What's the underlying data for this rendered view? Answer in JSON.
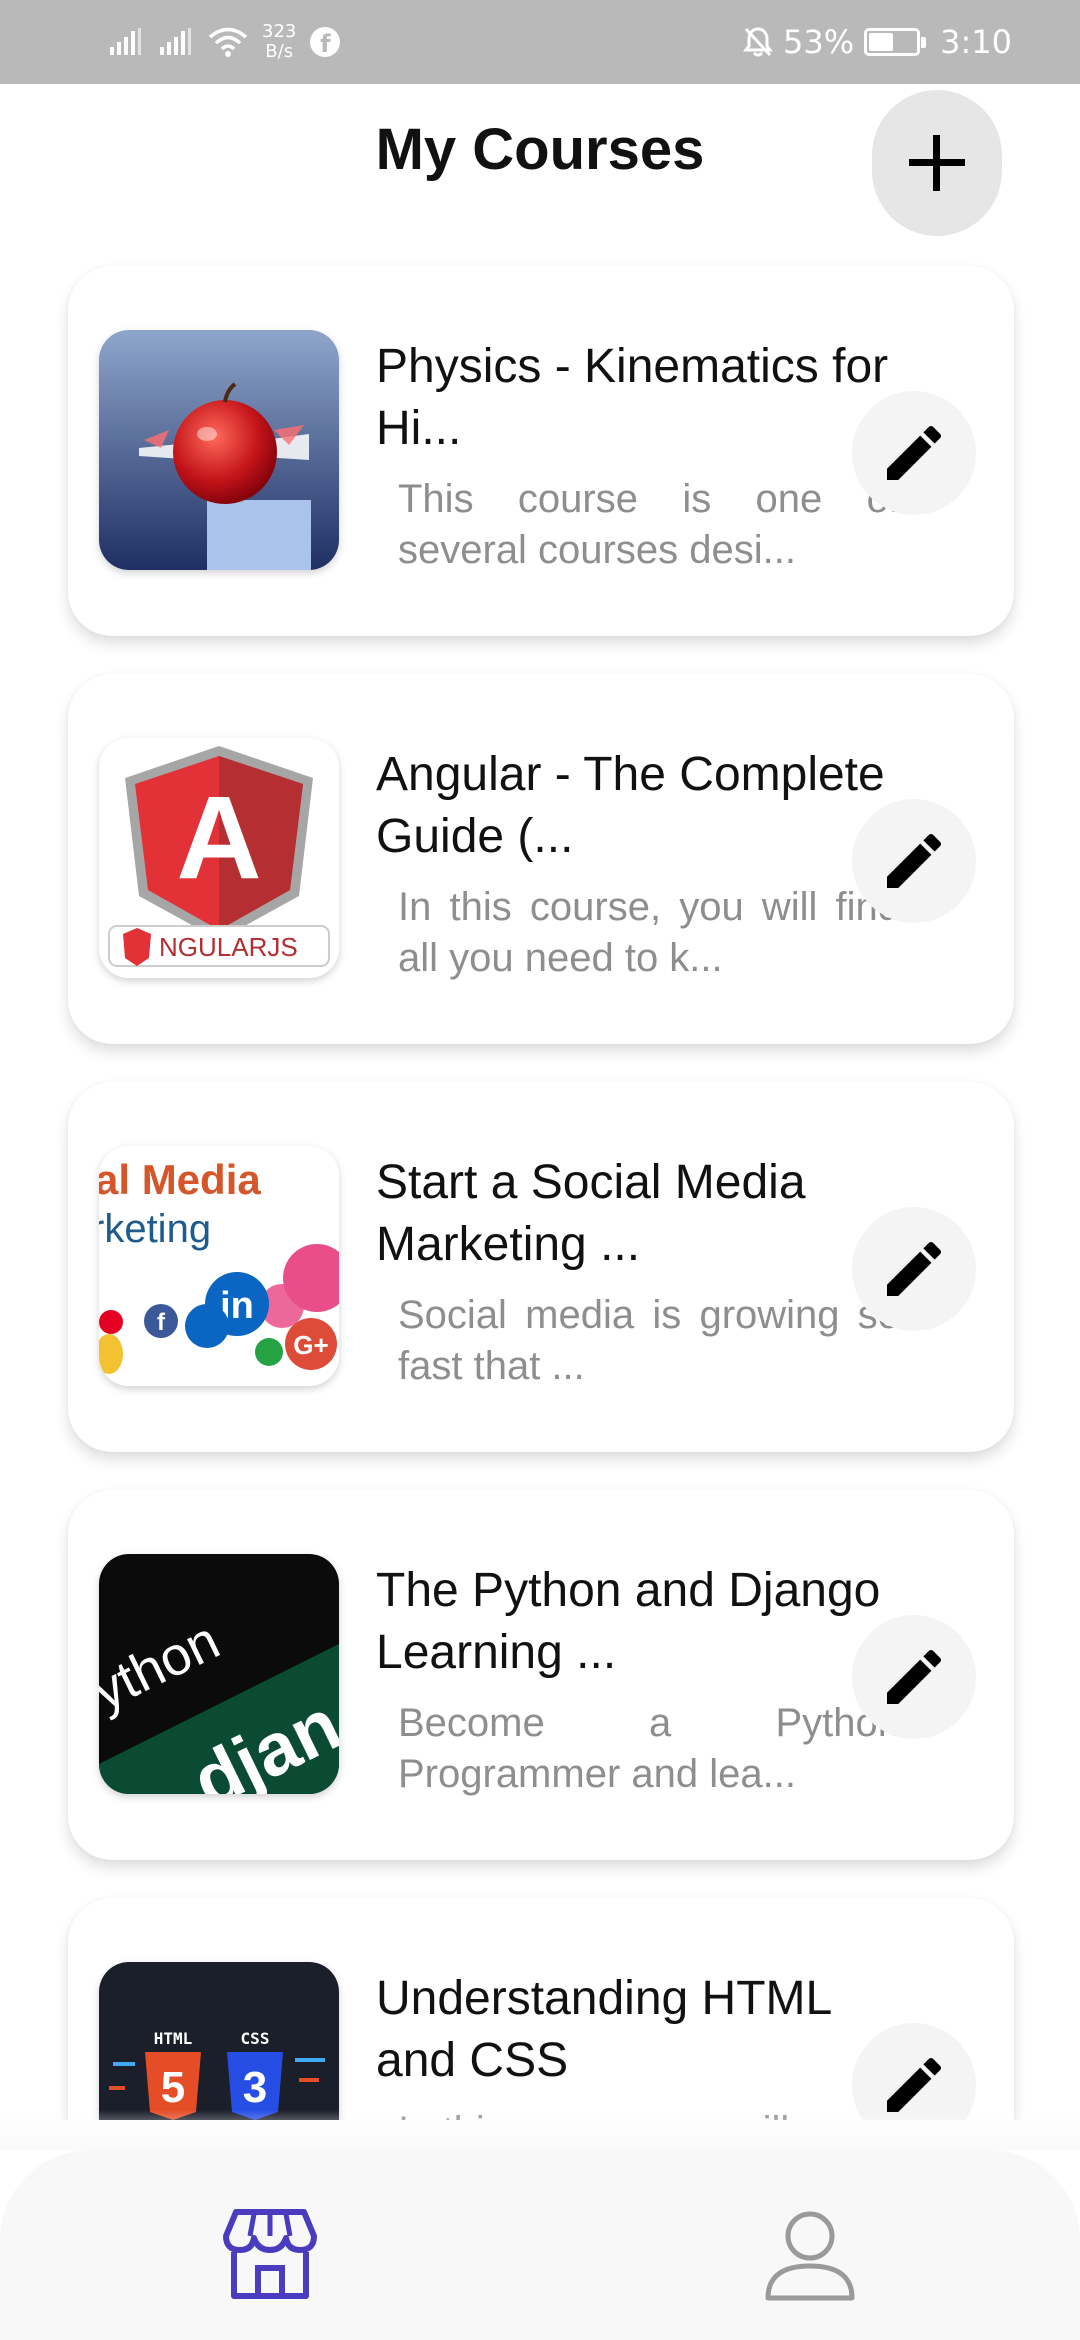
{
  "status_bar": {
    "net_speed_value": "323",
    "net_speed_unit": "B/s",
    "battery": "53%",
    "battery_level": 0.53,
    "time": "3:10",
    "facebook_glyph": "f"
  },
  "header": {
    "title": "My Courses",
    "add_icon": "plus-icon"
  },
  "courses": [
    {
      "title": "Physics - Kinematics for Hi...",
      "description": "This course is one of several courses desi...",
      "thumbnail": "apple-projectile"
    },
    {
      "title": "Angular - The Complete Guide (...",
      "description": "In this course, you will find all you need to k...",
      "thumbnail": "angularjs-logo",
      "thumb_text": "NGULARJS",
      "thumb_letter": "A"
    },
    {
      "title": "Start a Social Media Marketing ...",
      "description": "Social media is growing so fast that ...",
      "thumbnail": "social-media-icons",
      "thumb_line1": "al Media",
      "thumb_line2": "rketing",
      "thumb_in": "in",
      "thumb_f": "f",
      "thumb_g": "G+"
    },
    {
      "title": "The Python and Django Learning ...",
      "description": "Become a Python Programmer and lea...",
      "thumbnail": "python-django",
      "thumb_line1": "ython",
      "thumb_line2": "djan"
    },
    {
      "title": "Understanding HTML and CSS",
      "description": "In this course, you will...",
      "thumbnail": "html-css",
      "thumb_html": "HTML",
      "thumb_css": "CSS",
      "thumb_5": "5",
      "thumb_3": "3"
    }
  ],
  "bottom_nav": {
    "items": [
      {
        "icon": "store-icon",
        "active": true
      },
      {
        "icon": "profile-icon",
        "active": false
      }
    ],
    "active_color": "#4a3bbf",
    "inactive_color": "#9a9a9a"
  }
}
